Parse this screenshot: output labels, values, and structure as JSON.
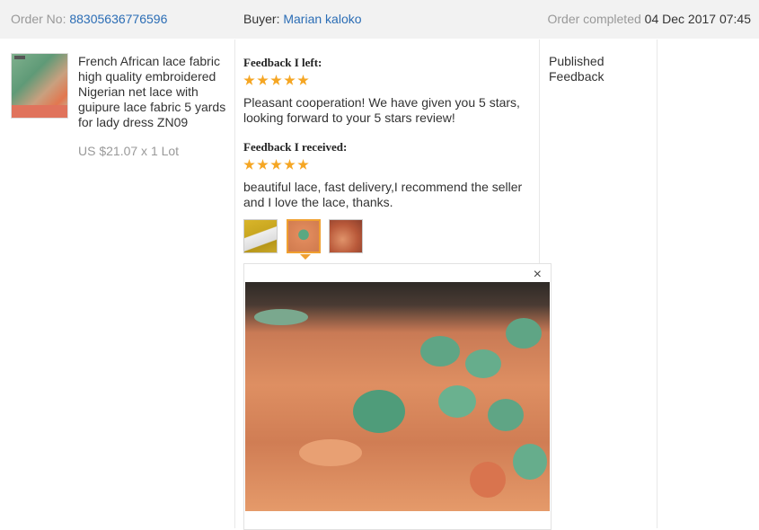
{
  "header": {
    "order_label": "Order No:",
    "order_number": "88305636776596",
    "buyer_label": "Buyer:",
    "buyer_name": "Marian kaloko",
    "status_label": "Order completed",
    "status_date": "04 Dec 2017 07:45"
  },
  "product": {
    "title": "French African lace fabric high quality embroidered Nigerian net lace with guipure lace fabric 5 yards for lady dress ZN09",
    "price": "US $21.07 x 1 Lot"
  },
  "feedback_left": {
    "label": "Feedback I left:",
    "rating": 5,
    "text": "Pleasant cooperation! We have given you 5 stars, looking forward to your 5 stars review!"
  },
  "feedback_received": {
    "label": "Feedback I received:",
    "rating": 5,
    "text": "beautiful lace, fast delivery,I recommend the seller and I love the lace, thanks.",
    "selected_photo": 2
  },
  "viewer": {
    "close_symbol": "×"
  },
  "status_column": {
    "text": "Published Feedback"
  },
  "colors": {
    "link": "#2b6db5",
    "muted": "#999999",
    "star": "#f5a623",
    "selected": "#f0a030",
    "header_bg": "#f2f2f2"
  }
}
